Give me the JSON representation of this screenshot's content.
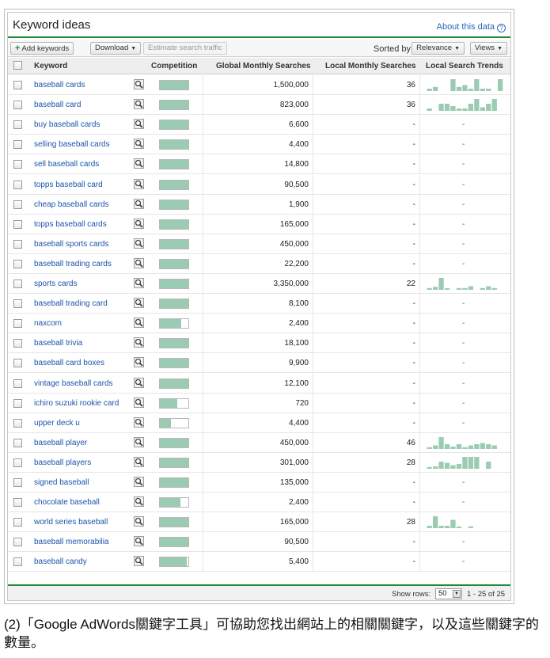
{
  "panel": {
    "title": "Keyword ideas",
    "about": "About this data",
    "help_glyph": "?"
  },
  "toolbar": {
    "add_keywords": "Add keywords",
    "download": "Download",
    "estimate": "Estimate search traffic",
    "sorted_by": "Sorted by",
    "relevance": "Relevance",
    "views": "Views"
  },
  "columns": {
    "keyword": "Keyword",
    "competition": "Competition",
    "global": "Global Monthly Searches",
    "local": "Local Monthly Searches",
    "trends": "Local Search Trends"
  },
  "rows": [
    {
      "keyword": "baseball cards",
      "competition": 1.0,
      "global": "1,500,000",
      "local": "36",
      "trend": [
        0.2,
        0.35,
        0,
        0,
        1,
        0.35,
        0.5,
        0.2,
        1,
        0.2,
        0.2,
        0,
        1
      ]
    },
    {
      "keyword": "baseball card",
      "competition": 1.0,
      "global": "823,000",
      "local": "36",
      "trend": [
        0.2,
        0,
        0.6,
        0.6,
        0.4,
        0.2,
        0.2,
        0.6,
        1,
        0.3,
        0.6,
        1
      ]
    },
    {
      "keyword": "buy baseball cards",
      "competition": 1.0,
      "global": "6,600",
      "local": "-",
      "trend": null
    },
    {
      "keyword": "selling baseball cards",
      "competition": 1.0,
      "global": "4,400",
      "local": "-",
      "trend": null
    },
    {
      "keyword": "sell baseball cards",
      "competition": 1.0,
      "global": "14,800",
      "local": "-",
      "trend": null
    },
    {
      "keyword": "topps baseball card",
      "competition": 1.0,
      "global": "90,500",
      "local": "-",
      "trend": null
    },
    {
      "keyword": "cheap baseball cards",
      "competition": 1.0,
      "global": "1,900",
      "local": "-",
      "trend": null
    },
    {
      "keyword": "topps baseball cards",
      "competition": 1.0,
      "global": "165,000",
      "local": "-",
      "trend": null
    },
    {
      "keyword": "baseball sports cards",
      "competition": 1.0,
      "global": "450,000",
      "local": "-",
      "trend": null
    },
    {
      "keyword": "baseball trading cards",
      "competition": 1.0,
      "global": "22,200",
      "local": "-",
      "trend": null
    },
    {
      "keyword": "sports cards",
      "competition": 1.0,
      "global": "3,350,000",
      "local": "22",
      "trend": [
        0.15,
        0.25,
        1,
        0.1,
        0,
        0.15,
        0.15,
        0.3,
        0,
        0.15,
        0.3,
        0.15
      ]
    },
    {
      "keyword": "baseball trading card",
      "competition": 1.0,
      "global": "8,100",
      "local": "-",
      "trend": null
    },
    {
      "keyword": "naxcom",
      "competition": 0.75,
      "global": "2,400",
      "local": "-",
      "trend": null
    },
    {
      "keyword": "baseball trivia",
      "competition": 1.0,
      "global": "18,100",
      "local": "-",
      "trend": null
    },
    {
      "keyword": "baseball card boxes",
      "competition": 1.0,
      "global": "9,900",
      "local": "-",
      "trend": null
    },
    {
      "keyword": "vintage baseball cards",
      "competition": 1.0,
      "global": "12,100",
      "local": "-",
      "trend": null
    },
    {
      "keyword": "ichiro suzuki rookie card",
      "competition": 0.6,
      "global": "720",
      "local": "-",
      "trend": null
    },
    {
      "keyword": "upper deck u",
      "competition": 0.4,
      "global": "4,400",
      "local": "-",
      "trend": null
    },
    {
      "keyword": "baseball player",
      "competition": 1.0,
      "global": "450,000",
      "local": "46",
      "trend": [
        0.15,
        0.3,
        1,
        0.4,
        0.2,
        0.4,
        0.15,
        0.3,
        0.4,
        0.5,
        0.4,
        0.3
      ]
    },
    {
      "keyword": "baseball players",
      "competition": 1.0,
      "global": "301,000",
      "local": "28",
      "trend": [
        0.15,
        0.2,
        0.6,
        0.5,
        0.3,
        0.4,
        1,
        1,
        1,
        0,
        0.6,
        0
      ]
    },
    {
      "keyword": "signed baseball",
      "competition": 1.0,
      "global": "135,000",
      "local": "-",
      "trend": null
    },
    {
      "keyword": "chocolate baseball",
      "competition": 0.72,
      "global": "2,400",
      "local": "-",
      "trend": null
    },
    {
      "keyword": "world series baseball",
      "competition": 1.0,
      "global": "165,000",
      "local": "28",
      "trend": [
        0.2,
        1,
        0.2,
        0.2,
        0.7,
        0.1,
        0,
        0.15
      ]
    },
    {
      "keyword": "baseball memorabilia",
      "competition": 1.0,
      "global": "90,500",
      "local": "-",
      "trend": null
    },
    {
      "keyword": "baseball candy",
      "competition": 0.95,
      "global": "5,400",
      "local": "-",
      "trend": null
    }
  ],
  "trend_dash": "-",
  "footer": {
    "show_rows": "Show rows:",
    "rows_value": "50",
    "range": "1 - 25 of 25"
  },
  "caption": "(2)「Google AdWords關鍵字工具」可協助您找出網站上的相關關鍵字，以及這些關鍵字的數量。",
  "colors": {
    "accent_green": "#1e8a3a",
    "bar_green": "#9ccbb3",
    "link_blue": "#1a55aa"
  }
}
